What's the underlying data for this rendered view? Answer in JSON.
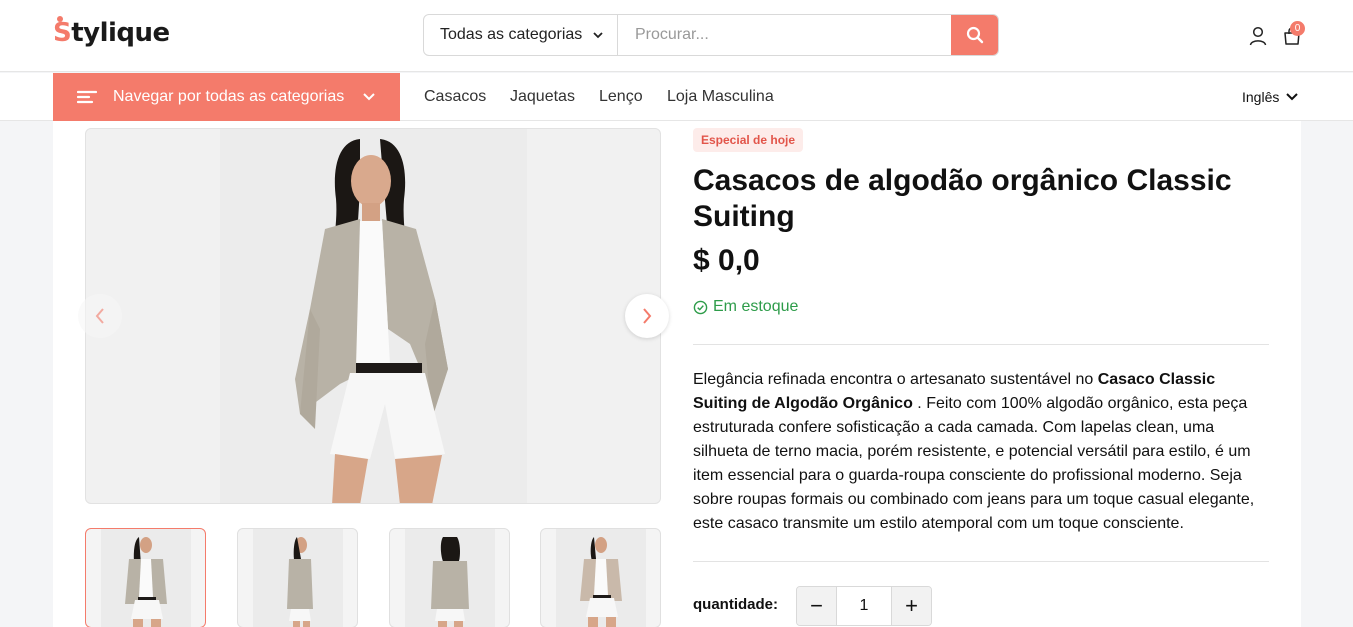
{
  "header": {
    "logo_text": "tylique",
    "logo_initial": "S",
    "category_select": "Todas as categorias",
    "search_placeholder": "Procurar...",
    "cart_count": "0"
  },
  "nav": {
    "browse_label": "Navegar por todas as categorias",
    "links": [
      "Casacos",
      "Jaquetas",
      "Lenço",
      "Loja Masculina"
    ],
    "language": "Inglês"
  },
  "product": {
    "badge": "Especial de hoje",
    "title": "Casacos de algodão orgânico Classic Suiting",
    "price": "$ 0,0",
    "stock": "Em estoque",
    "desc_intro": "Elegância refinada encontra o artesanato sustentável no ",
    "desc_bold": "Casaco Classic Suiting de Algodão Orgânico",
    "desc_rest": " . Feito com 100% algodão orgânico, esta peça estruturada confere sofisticação a cada camada. Com lapelas clean, uma silhueta de terno macia, porém resistente, e potencial versátil para estilo, é um item essencial para o guarda-roupa consciente do profissional moderno. Seja sobre roupas formais ou combinado com jeans para um toque casual elegante, este casaco transmite um estilo atemporal com um toque consciente.",
    "quantity_label": "quantidade:",
    "quantity_value": "1",
    "minus": "−",
    "plus": "+"
  },
  "colors": {
    "accent": "#f47b6b",
    "stock_green": "#2e9c4a",
    "badge_bg": "#fdecea"
  }
}
